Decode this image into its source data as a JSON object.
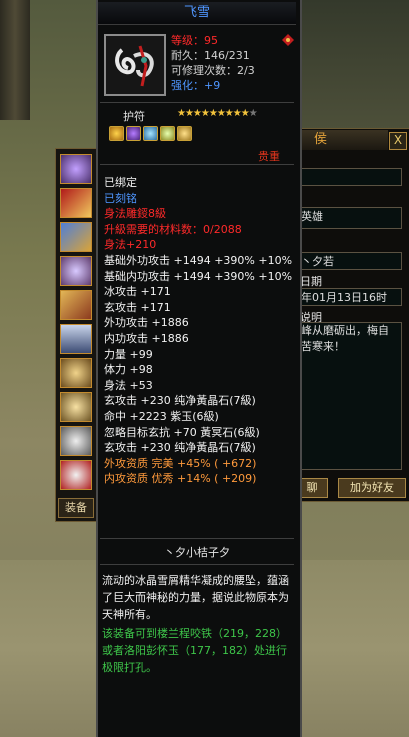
{
  "character_window": {
    "title": "侯",
    "close_label": "X",
    "name_value": "英雄",
    "title_value": "丶夕若",
    "date_label": "日期",
    "date_value": "年01月13日16时",
    "desc_label": "说明",
    "desc_value": "峰从磨砺出，梅自苦寒来！",
    "btn_left": "聊",
    "btn_right": "加为好友"
  },
  "equip_column": {
    "label": "装备"
  },
  "tooltip": {
    "title": "飞雪",
    "level": "等级：95",
    "durability": "耐久：146/231",
    "repair": "可修理次数：2/3",
    "enhance": "强化：+9",
    "amulet_label": "护符",
    "stars": "★★★★★★★★★",
    "grade": "贵重",
    "lines": [
      {
        "text": "已绑定",
        "color": "#f2f2f2"
      },
      {
        "text": "已刻铭",
        "color": "#4f96ff"
      },
      {
        "text": "身法雕鋄8級",
        "color": "#ff2a2a"
      },
      {
        "text": "升級需要的材料数：0/2088",
        "color": "#ff2a2a"
      },
      {
        "text": "身法+210",
        "color": "#ff2a2a"
      },
      {
        "text": "基础外功攻击 +1494 +390% +10%",
        "color": "#f2f2f2"
      },
      {
        "text": "基础内功攻击 +1494 +390% +10%",
        "color": "#f2f2f2"
      },
      {
        "text": "冰攻击 +171",
        "color": "#f2f2f2"
      },
      {
        "text": "玄攻击 +171",
        "color": "#f2f2f2"
      },
      {
        "text": "外功攻击 +1886",
        "color": "#f2f2f2"
      },
      {
        "text": "内功攻击 +1886",
        "color": "#f2f2f2"
      },
      {
        "text": "力量 +99",
        "color": "#f2f2f2"
      },
      {
        "text": "体力 +98",
        "color": "#f2f2f2"
      },
      {
        "text": "身法 +53",
        "color": "#f2f2f2"
      },
      {
        "text": "玄攻击 +230 纯净黃晶石(7級)",
        "color": "#f2f2f2"
      },
      {
        "text": "命中 +2223 紫玉(6級)",
        "color": "#f2f2f2"
      },
      {
        "text": "忽略目标玄抗 +70 黃冥石(6級)",
        "color": "#f2f2f2"
      },
      {
        "text": "玄攻击 +230 纯净黃晶石(7級)",
        "color": "#f2f2f2"
      },
      {
        "text": "外攻资质  完美 +45% ( +672)",
        "color": "#ff9a3c"
      },
      {
        "text": "内攻资质  优秀 +14% ( +209)",
        "color": "#ff9a3c"
      }
    ],
    "signature": "丶夕小桔子夕",
    "description": "流动的冰晶雪屑精华凝成的腰坠，蕴涵了巨大而神秘的力量，据说此物原本为天神所有。",
    "location_text": "该装备可到楼兰程咬铁（219，228）或者洛阳彭怀玉（177，182）处进行极限打孔。",
    "colors": {
      "title": "#4f96ff",
      "level": "#ff2a2a",
      "info": "#d2d2d2",
      "enhance": "#4f96ff",
      "grade": "#e3351d",
      "location": "#3ec64a"
    }
  }
}
